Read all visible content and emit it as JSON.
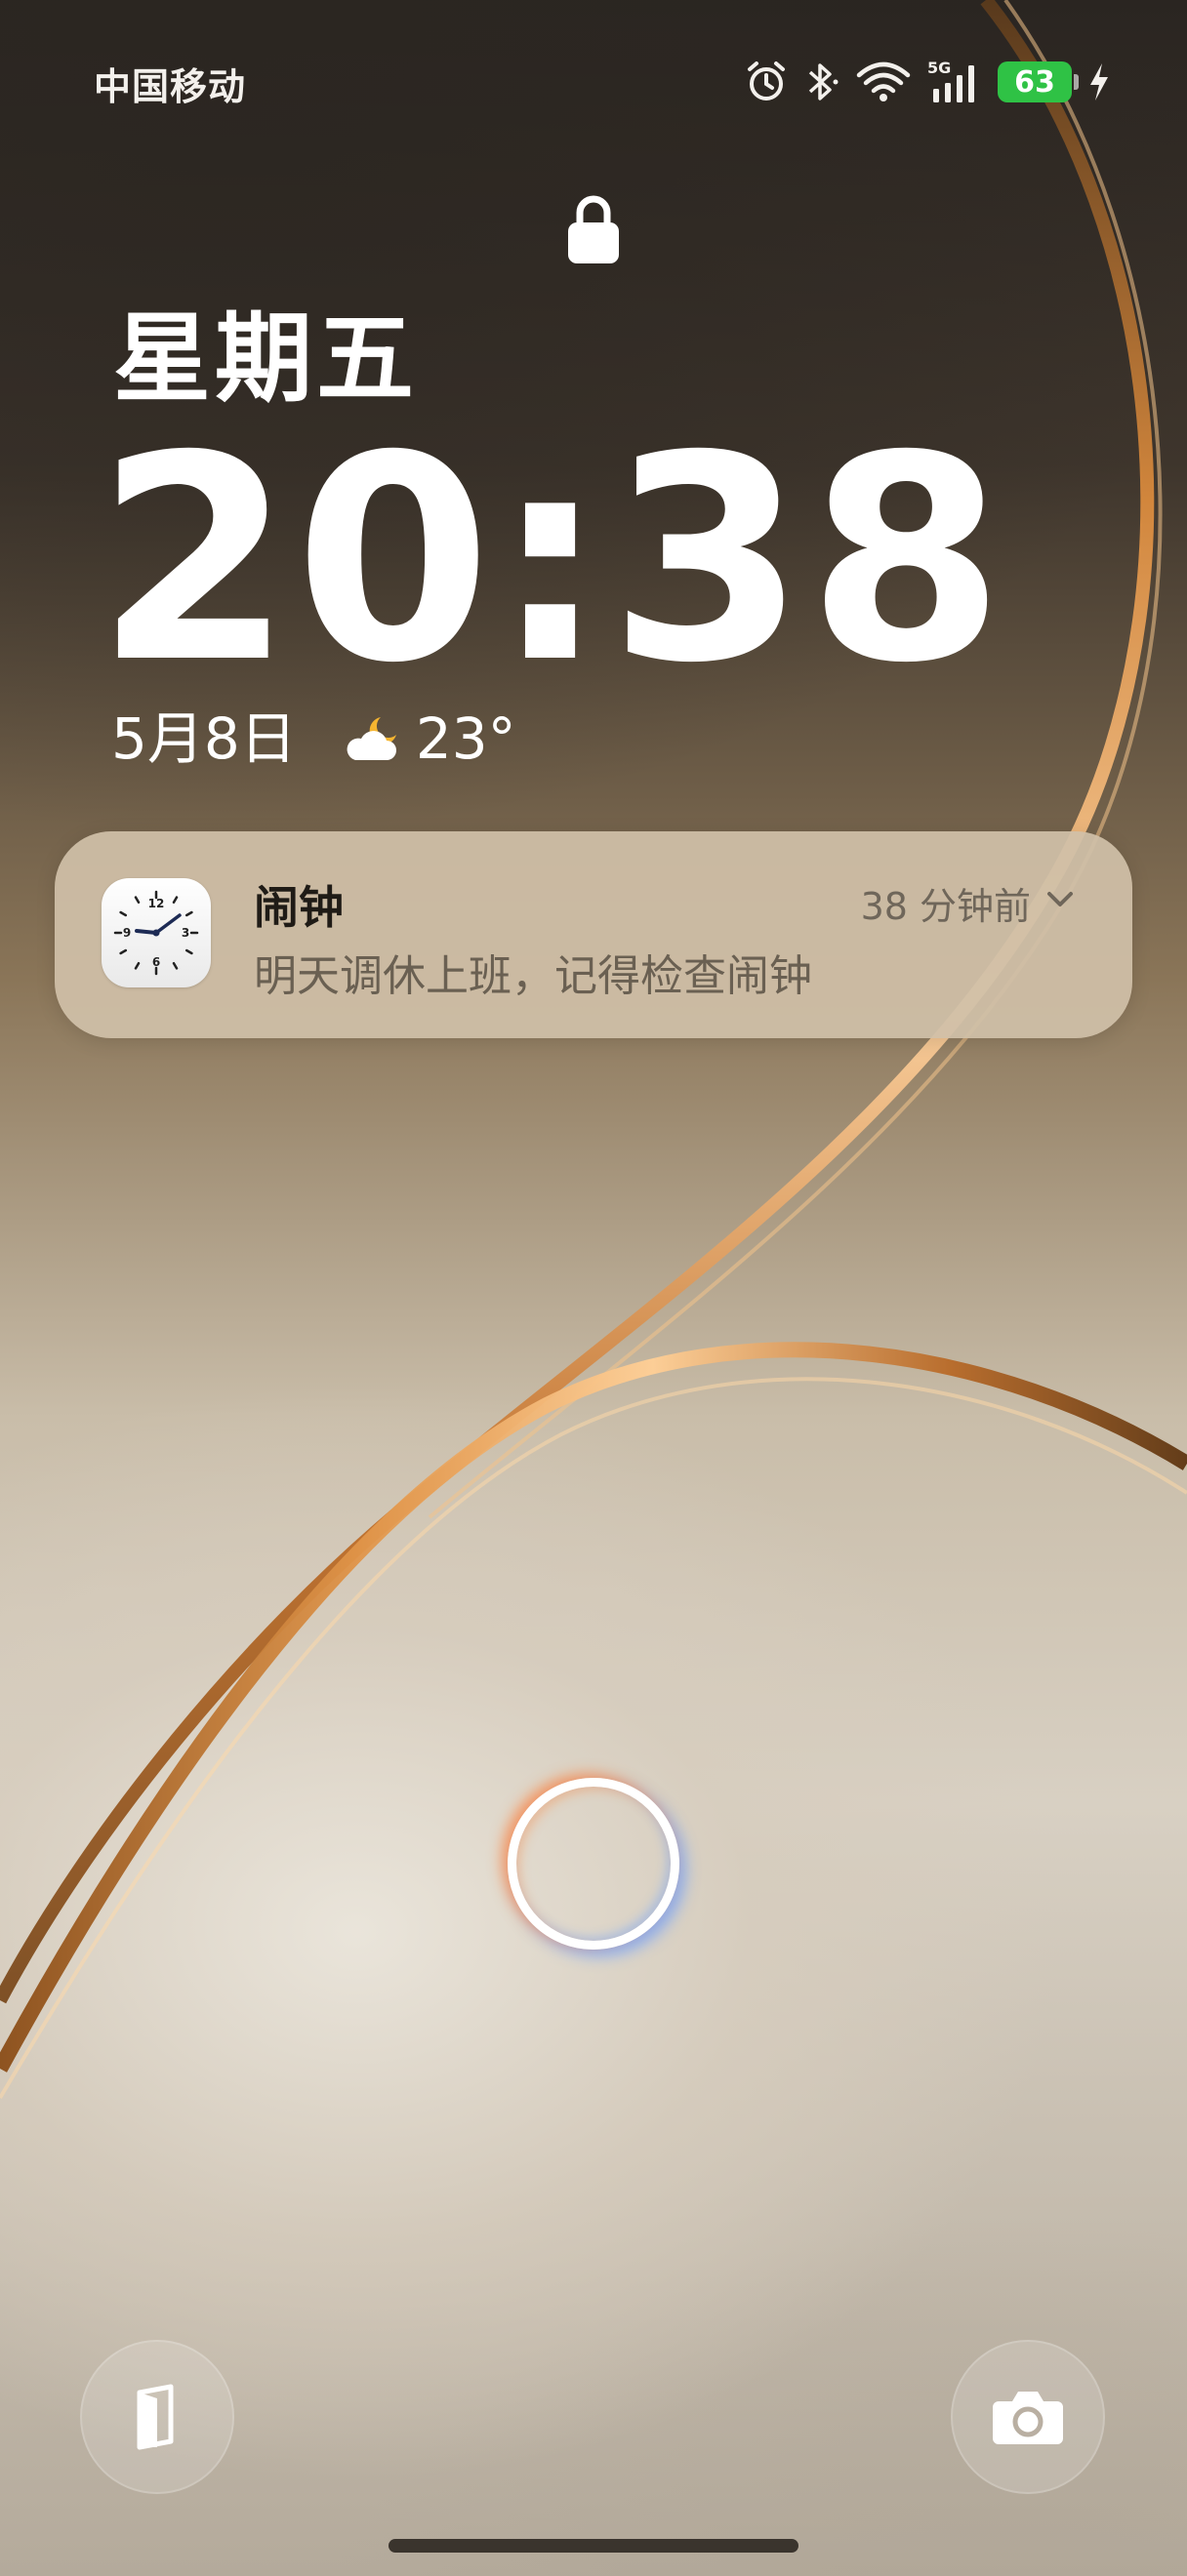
{
  "status_bar": {
    "carrier": "中国移动",
    "network": "5G",
    "battery_level": "63",
    "battery_color": "#2fc245",
    "icons": [
      "alarm-icon",
      "bluetooth-icon",
      "wifi-icon",
      "cellular-signal-icon",
      "battery-icon",
      "charging-icon"
    ]
  },
  "lock_screen": {
    "weekday": "星期五",
    "time": "20:38",
    "date": "5月8日",
    "temperature": "23°",
    "weather_icon": "partly-cloudy-night-icon"
  },
  "notification": {
    "app_name": "闹钟",
    "time_ago": "38 分钟前",
    "message": "明天调休上班，记得检查闹钟",
    "icon": "clock-app-icon"
  },
  "shortcuts": {
    "left": "wallet-card-icon",
    "right": "camera-icon"
  },
  "colors": {
    "accent_copper": "#c8782f",
    "notification_bg": "#d0c0a8"
  }
}
